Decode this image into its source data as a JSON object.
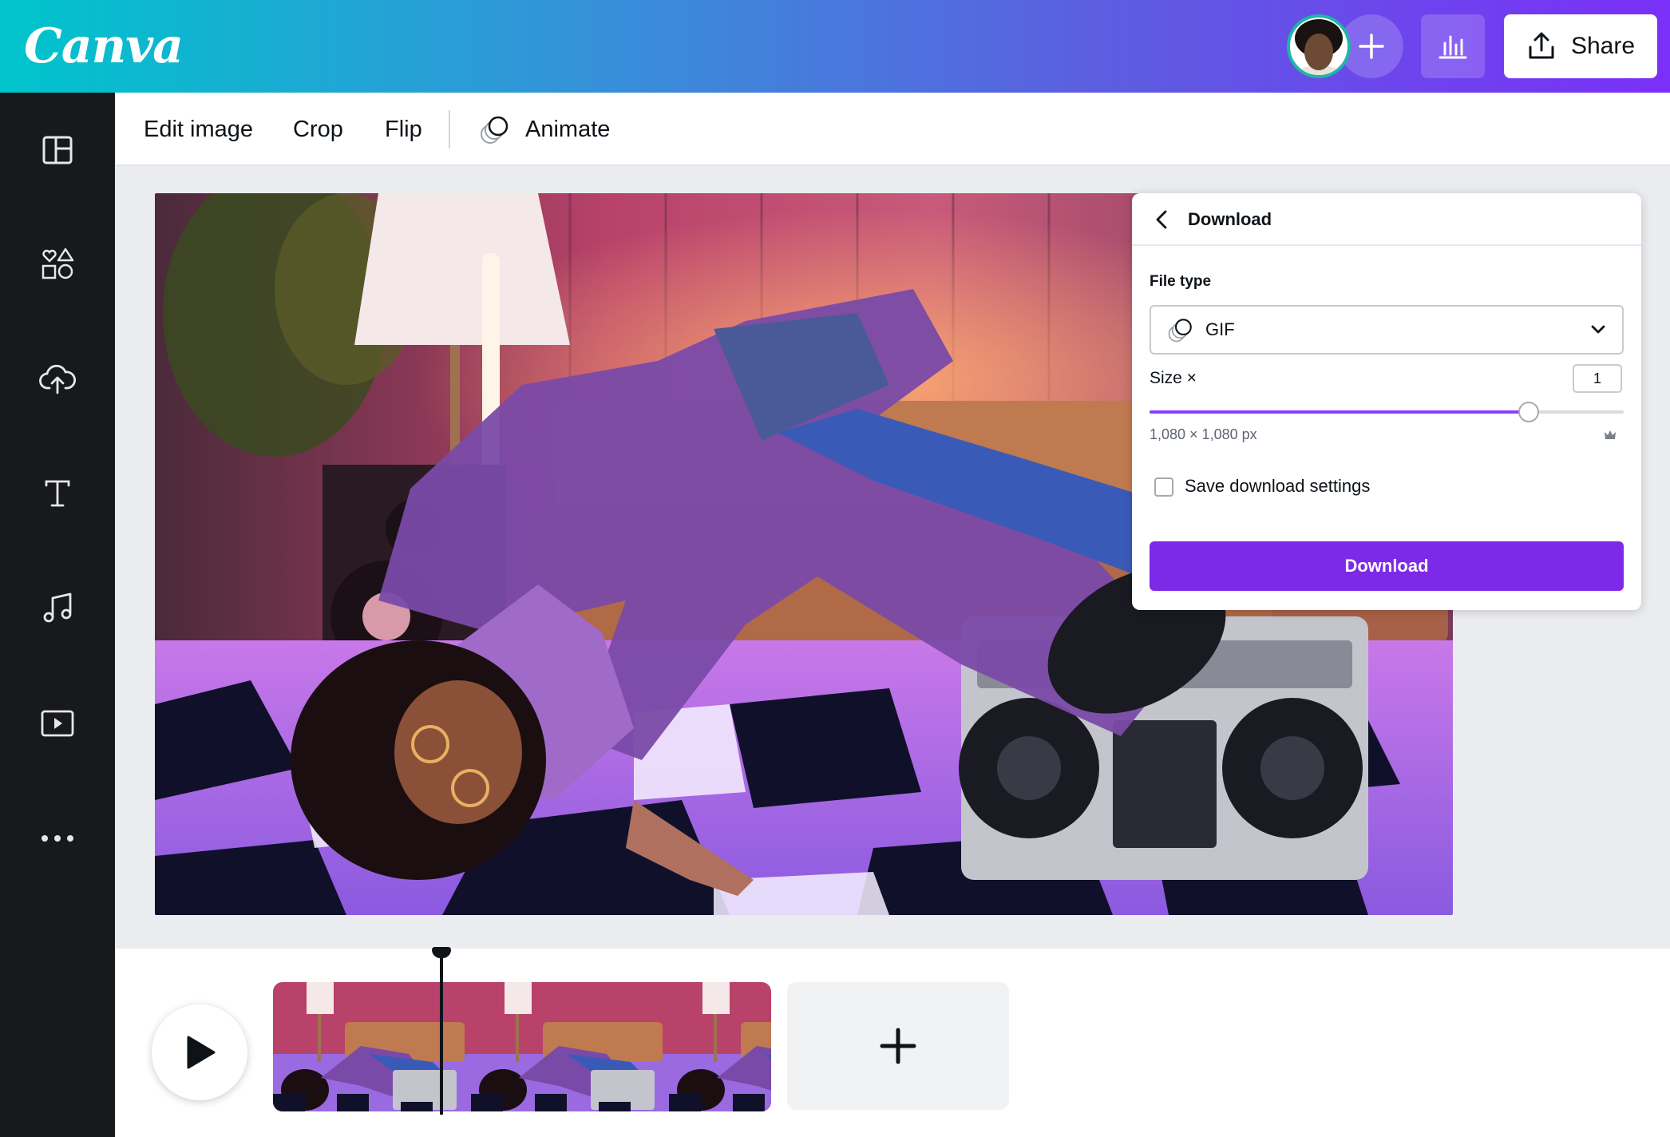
{
  "app": {
    "brand": "Canva"
  },
  "header": {
    "share_label": "Share"
  },
  "toolbar": {
    "edit_image": "Edit image",
    "crop": "Crop",
    "flip": "Flip",
    "animate": "Animate"
  },
  "download_panel": {
    "title": "Download",
    "file_type_label": "File type",
    "file_type_value": "GIF",
    "size_label": "Size ×",
    "size_value": "1",
    "size_fraction": 0.8,
    "dimensions": "1,080 × 1,080 px",
    "save_settings_label": "Save download settings",
    "save_settings_checked": false,
    "download_button": "Download"
  },
  "colors": {
    "accent": "#7d2ae8",
    "sidebar": "#18191b",
    "gradient_start": "#00c4cc",
    "gradient_end": "#7b2ff7"
  },
  "icons": [
    "templates-icon",
    "elements-icon",
    "uploads-icon",
    "text-icon",
    "audio-icon",
    "videos-icon",
    "more-icon",
    "animate-icon",
    "chevron-down-icon",
    "back-chevron-icon",
    "crown-icon",
    "play-icon",
    "plus-icon",
    "share-icon",
    "insights-icon"
  ]
}
